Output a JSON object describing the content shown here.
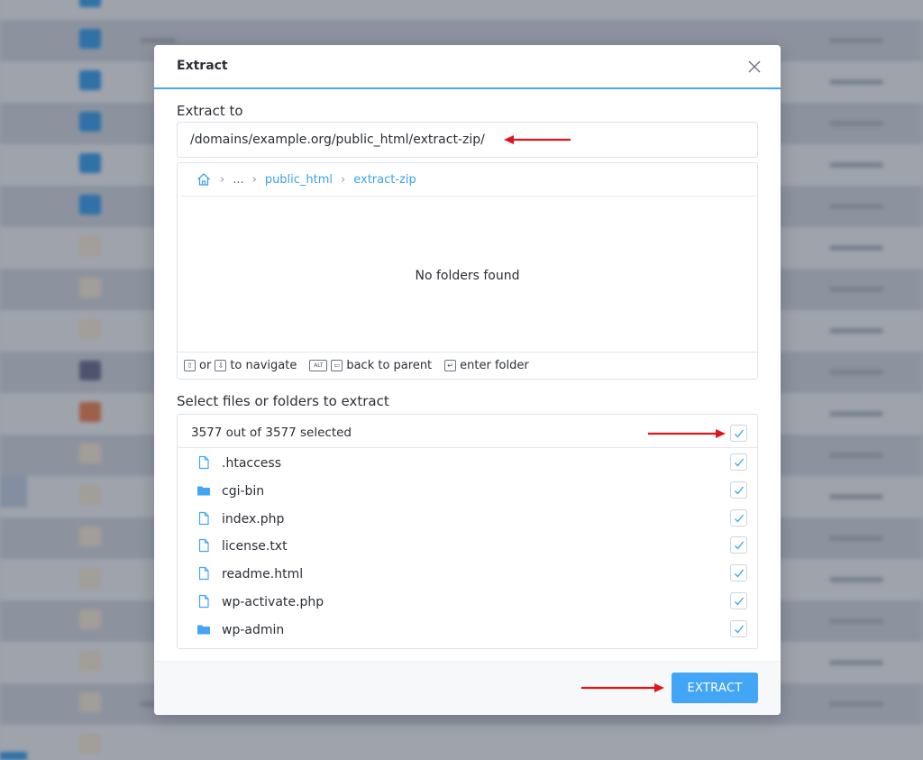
{
  "dialog": {
    "title": "Extract",
    "close_label": "×",
    "extract_to_label": "Extract to",
    "path_value": "/domains/example.org/public_html/extract-zip/",
    "breadcrumb": {
      "ellipsis": "...",
      "items": [
        "public_html",
        "extract-zip"
      ]
    },
    "empty_message": "No folders found",
    "hints": {
      "or": "or",
      "navigate": "to navigate",
      "alt_key": "ALT",
      "back": "back to parent",
      "enter": "enter folder"
    },
    "select_label": "Select files or folders to extract",
    "selected_count": "3577 out of 3577 selected",
    "files": [
      {
        "name": ".htaccess",
        "type": "file",
        "checked": true
      },
      {
        "name": "cgi-bin",
        "type": "folder",
        "checked": true
      },
      {
        "name": "index.php",
        "type": "file",
        "checked": true
      },
      {
        "name": "license.txt",
        "type": "file",
        "checked": true
      },
      {
        "name": "readme.html",
        "type": "file",
        "checked": true
      },
      {
        "name": "wp-activate.php",
        "type": "file",
        "checked": true
      },
      {
        "name": "wp-admin",
        "type": "folder",
        "checked": true
      }
    ],
    "extract_button": "EXTRACT"
  },
  "colors": {
    "accent": "#42a5f5",
    "link": "#3ba3e8",
    "annotation_arrow": "#e0141b"
  }
}
